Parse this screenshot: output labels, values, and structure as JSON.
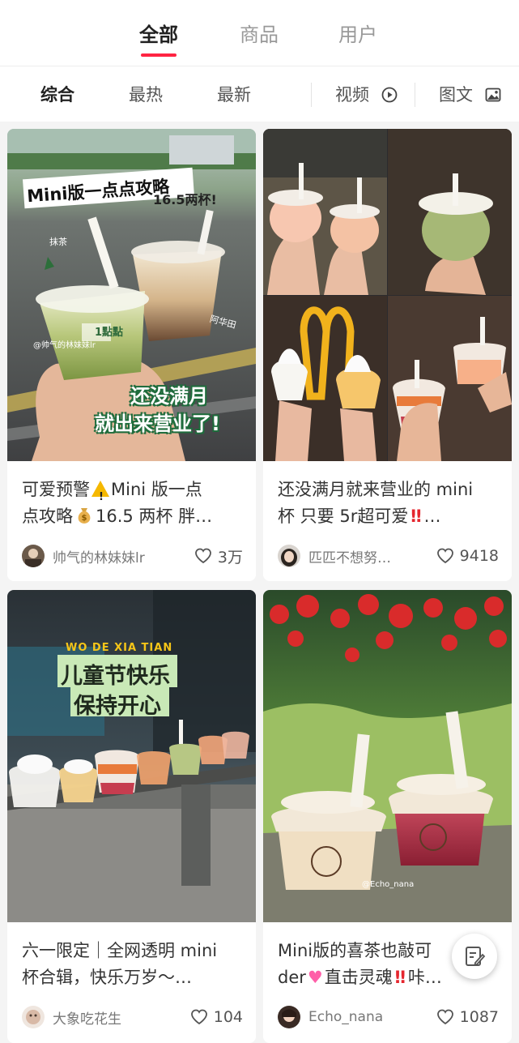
{
  "top_tabs": [
    {
      "label": "全部",
      "active": true
    },
    {
      "label": "商品",
      "active": false
    },
    {
      "label": "用户",
      "active": false
    }
  ],
  "filters": {
    "sort": [
      "综合",
      "最热",
      "最新"
    ],
    "video": "视频",
    "image_text": "图文"
  },
  "accent_color": "#ff2442",
  "cards": [
    {
      "title_a": "可爱预警",
      "title_b": "Mini 版一点",
      "title_c": "点攻略",
      "title_d": "16.5 两杯 胖…",
      "author": "帅气的林妹妹lr",
      "likes": "3万",
      "overlay": {
        "headline": "Mini版一点点攻略",
        "price": "16.5两杯!",
        "caption_1": "还没满月",
        "caption_2": "就出来营业了!",
        "label_left": "抹茶",
        "label_right": "阿华田",
        "cup_brand": "1點點",
        "watermark": "@帅气的林妹妹lr"
      }
    },
    {
      "title_a": "还没满月就来营业的 mini",
      "title_b": "杯 只要 5r超可爱",
      "title_c": "…",
      "author": "匹匹不想努…",
      "likes": "9418"
    },
    {
      "title_a": "六一限定｜全网透明 mini",
      "title_b": "杯合辑，快乐万岁～…",
      "author": "大象吃花生",
      "likes": "104",
      "overlay": {
        "sub": "WO DE XIA TIAN",
        "line1": "儿童节快乐",
        "line2": "保持开心"
      }
    },
    {
      "title_a": "Mini版的喜茶也敲可",
      "title_b": "der",
      "title_c": "直击灵魂",
      "title_d": "咔…",
      "author": "Echo_nana",
      "likes": "1087",
      "overlay": {
        "watermark": "@Echo_nana"
      }
    }
  ],
  "icons": [
    "play-circle-icon",
    "image-icon",
    "heart-icon",
    "warning-icon",
    "money-bag-icon",
    "double-exclamation-icon",
    "pink-heart-icon",
    "edit-note-icon"
  ]
}
